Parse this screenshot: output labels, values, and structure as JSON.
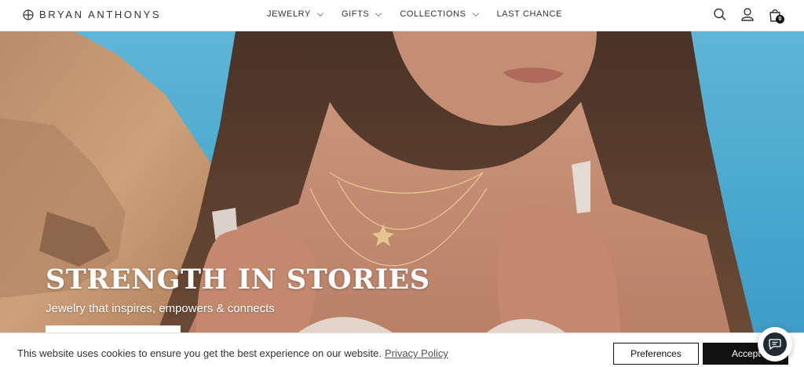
{
  "brand": {
    "name": "BRYAN ANTHONYS"
  },
  "nav": {
    "items": [
      {
        "label": "JEWELRY",
        "has_dropdown": true
      },
      {
        "label": "GIFTS",
        "has_dropdown": true
      },
      {
        "label": "COLLECTIONS",
        "has_dropdown": true
      },
      {
        "label": "LAST CHANCE",
        "has_dropdown": false
      }
    ]
  },
  "header_icons": {
    "search": "search-icon",
    "account": "user-icon",
    "cart": "shopping-bag-icon",
    "cart_count": "0"
  },
  "hero": {
    "title": "STRENGTH IN STORIES",
    "subtitle": "Jewelry that inspires, empowers & connects"
  },
  "cookie": {
    "message": "This website uses cookies to ensure you get the best experience on our website.",
    "link_label": "Privacy Policy",
    "preferences_label": "Preferences",
    "accept_label": "Accept"
  },
  "chat": {
    "icon": "chat-icon"
  },
  "colors": {
    "sky": "#4aa8cf",
    "rock": "#c89a72",
    "dark": "#111111",
    "white": "#ffffff"
  }
}
